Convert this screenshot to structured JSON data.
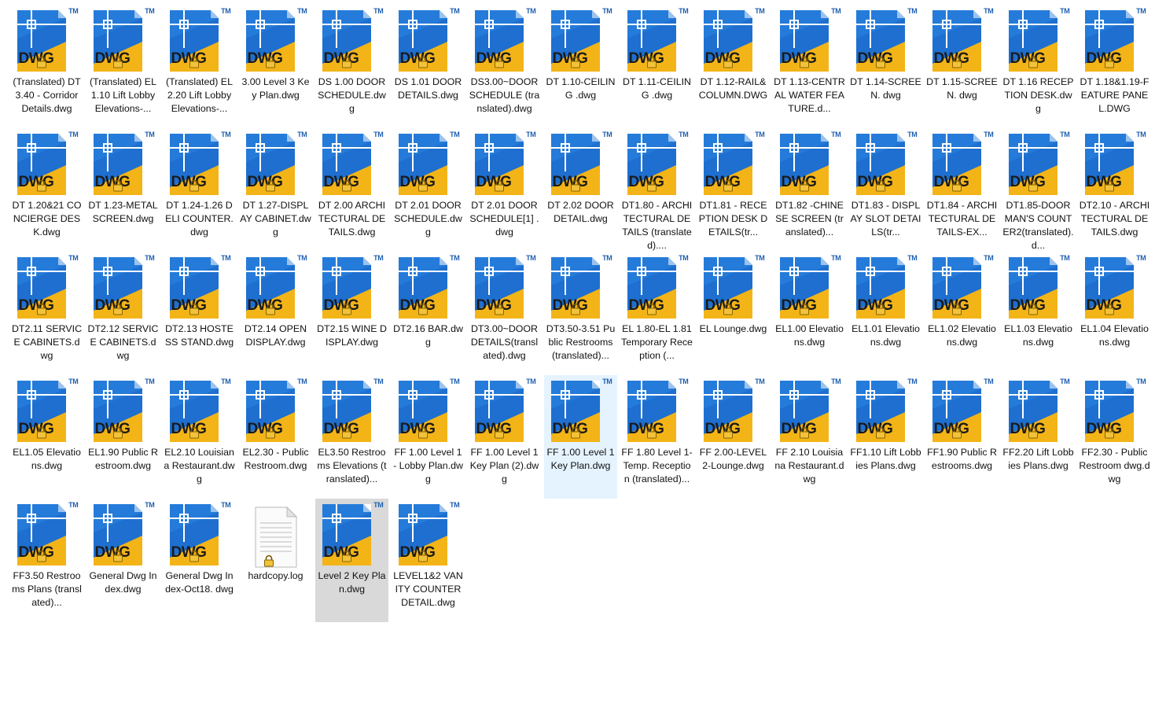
{
  "icon_labels": {
    "tm": "TM",
    "dwg": "DWG"
  },
  "files": [
    {
      "name": "(Translated) DT3.40 - Corridor Details.dwg",
      "type": "dwg"
    },
    {
      "name": "(Translated) EL1.10 Lift Lobby Elevations-...",
      "type": "dwg"
    },
    {
      "name": "(Translated) EL2.20 Lift Lobby Elevations-...",
      "type": "dwg"
    },
    {
      "name": "3.00 Level 3 Key Plan.dwg",
      "type": "dwg"
    },
    {
      "name": "DS 1.00 DOOR SCHEDULE.dwg",
      "type": "dwg"
    },
    {
      "name": "DS 1.01 DOOR DETAILS.dwg",
      "type": "dwg"
    },
    {
      "name": "DS3.00~DOOR SCHEDULE (translated).dwg",
      "type": "dwg"
    },
    {
      "name": "DT 1.10-CEILING .dwg",
      "type": "dwg"
    },
    {
      "name": "DT 1.11-CEILING .dwg",
      "type": "dwg"
    },
    {
      "name": "DT 1.12-RAIL&COLUMN.DWG",
      "type": "dwg"
    },
    {
      "name": "DT 1.13-CENTRAL WATER FEATURE.d...",
      "type": "dwg"
    },
    {
      "name": "DT 1.14-SCREEN. dwg",
      "type": "dwg"
    },
    {
      "name": "DT 1.15-SCREEN. dwg",
      "type": "dwg"
    },
    {
      "name": "DT 1.16 RECEPTION DESK.dwg",
      "type": "dwg"
    },
    {
      "name": "DT 1.18&1.19-FEATURE PANEL.DWG",
      "type": "dwg"
    },
    {
      "name": "DT 1.20&21 CONCIERGE DESK.dwg",
      "type": "dwg"
    },
    {
      "name": "DT 1.23-METAL SCREEN.dwg",
      "type": "dwg"
    },
    {
      "name": "DT 1.24-1.26 DELI COUNTER.dwg",
      "type": "dwg"
    },
    {
      "name": "DT 1.27-DISPLAY CABINET.dwg",
      "type": "dwg"
    },
    {
      "name": "DT 2.00 ARCHITECTURAL DETAILS.dwg",
      "type": "dwg"
    },
    {
      "name": "DT 2.01 DOOR SCHEDULE.dwg",
      "type": "dwg"
    },
    {
      "name": "DT 2.01 DOOR SCHEDULE[1] .dwg",
      "type": "dwg"
    },
    {
      "name": "DT 2.02 DOOR DETAIL.dwg",
      "type": "dwg"
    },
    {
      "name": "DT1.80 - ARCHITECTURAL DETAILS (translated)....",
      "type": "dwg"
    },
    {
      "name": "DT1.81 - RECEPTION DESK DETAILS(tr...",
      "type": "dwg"
    },
    {
      "name": "DT1.82 -CHINESE SCREEN (translated)...",
      "type": "dwg"
    },
    {
      "name": "DT1.83 - DISPLAY SLOT DETAILS(tr...",
      "type": "dwg"
    },
    {
      "name": "DT1.84 - ARCHITECTURAL DETAILS-EX...",
      "type": "dwg"
    },
    {
      "name": "DT1.85-DOORMAN'S COUNTER2(translated).d...",
      "type": "dwg"
    },
    {
      "name": "DT2.10 - ARCHITECTURAL DETAILS.dwg",
      "type": "dwg"
    },
    {
      "name": "DT2.11 SERVICE CABINETS.dwg",
      "type": "dwg"
    },
    {
      "name": "DT2.12 SERVICE CABINETS.dwg",
      "type": "dwg"
    },
    {
      "name": "DT2.13 HOSTESS STAND.dwg",
      "type": "dwg"
    },
    {
      "name": "DT2.14 OPEN DISPLAY.dwg",
      "type": "dwg"
    },
    {
      "name": "DT2.15 WINE DISPLAY.dwg",
      "type": "dwg"
    },
    {
      "name": "DT2.16 BAR.dwg",
      "type": "dwg"
    },
    {
      "name": "DT3.00~DOOR DETAILS(translated).dwg",
      "type": "dwg"
    },
    {
      "name": "DT3.50-3.51 Public Restrooms (translated)...",
      "type": "dwg"
    },
    {
      "name": "EL 1.80-EL 1.81 Temporary Reception (...",
      "type": "dwg"
    },
    {
      "name": "EL Lounge.dwg",
      "type": "dwg"
    },
    {
      "name": "EL1.00 Elevations.dwg",
      "type": "dwg"
    },
    {
      "name": "EL1.01 Elevations.dwg",
      "type": "dwg"
    },
    {
      "name": "EL1.02 Elevations.dwg",
      "type": "dwg"
    },
    {
      "name": "EL1.03 Elevations.dwg",
      "type": "dwg"
    },
    {
      "name": "EL1.04 Elevations.dwg",
      "type": "dwg"
    },
    {
      "name": "EL1.05 Elevations.dwg",
      "type": "dwg"
    },
    {
      "name": "EL1.90 Public Restroom.dwg",
      "type": "dwg"
    },
    {
      "name": "EL2.10 Louisiana Restaurant.dwg",
      "type": "dwg"
    },
    {
      "name": "EL2.30 - Public Restroom.dwg",
      "type": "dwg"
    },
    {
      "name": "EL3.50 Restrooms Elevations (translated)...",
      "type": "dwg"
    },
    {
      "name": "FF 1.00 Level 1 - Lobby Plan.dwg",
      "type": "dwg"
    },
    {
      "name": "FF 1.00 Level 1 Key Plan (2).dwg",
      "type": "dwg"
    },
    {
      "name": "FF 1.00 Level 1 Key Plan.dwg",
      "type": "dwg",
      "state": "hover"
    },
    {
      "name": "FF 1.80 Level 1-Temp. Reception (translated)...",
      "type": "dwg"
    },
    {
      "name": "FF 2.00-LEVEL 2-Lounge.dwg",
      "type": "dwg"
    },
    {
      "name": "FF 2.10 Louisiana Restaurant.dwg",
      "type": "dwg"
    },
    {
      "name": "FF1.10 Lift Lobbies Plans.dwg",
      "type": "dwg"
    },
    {
      "name": "FF1.90 Public Restrooms.dwg",
      "type": "dwg"
    },
    {
      "name": "FF2.20 Lift Lobbies Plans.dwg",
      "type": "dwg"
    },
    {
      "name": "FF2.30 - Public Restroom dwg.dwg",
      "type": "dwg"
    },
    {
      "name": "FF3.50 Restrooms Plans (translated)...",
      "type": "dwg"
    },
    {
      "name": "General Dwg Index.dwg",
      "type": "dwg"
    },
    {
      "name": "General Dwg Index-Oct18. dwg",
      "type": "dwg"
    },
    {
      "name": "hardcopy.log",
      "type": "log"
    },
    {
      "name": "Level 2 Key Plan.dwg",
      "type": "dwg",
      "state": "selected"
    },
    {
      "name": "LEVEL1&2 VANITY COUNTER DETAIL.dwg",
      "type": "dwg"
    }
  ],
  "colors": {
    "dwg_blue": "#1e6fcf",
    "dwg_yellow": "#f3b418",
    "hover_bg": "#e5f3ff",
    "selected_bg": "#d9d9d9"
  }
}
